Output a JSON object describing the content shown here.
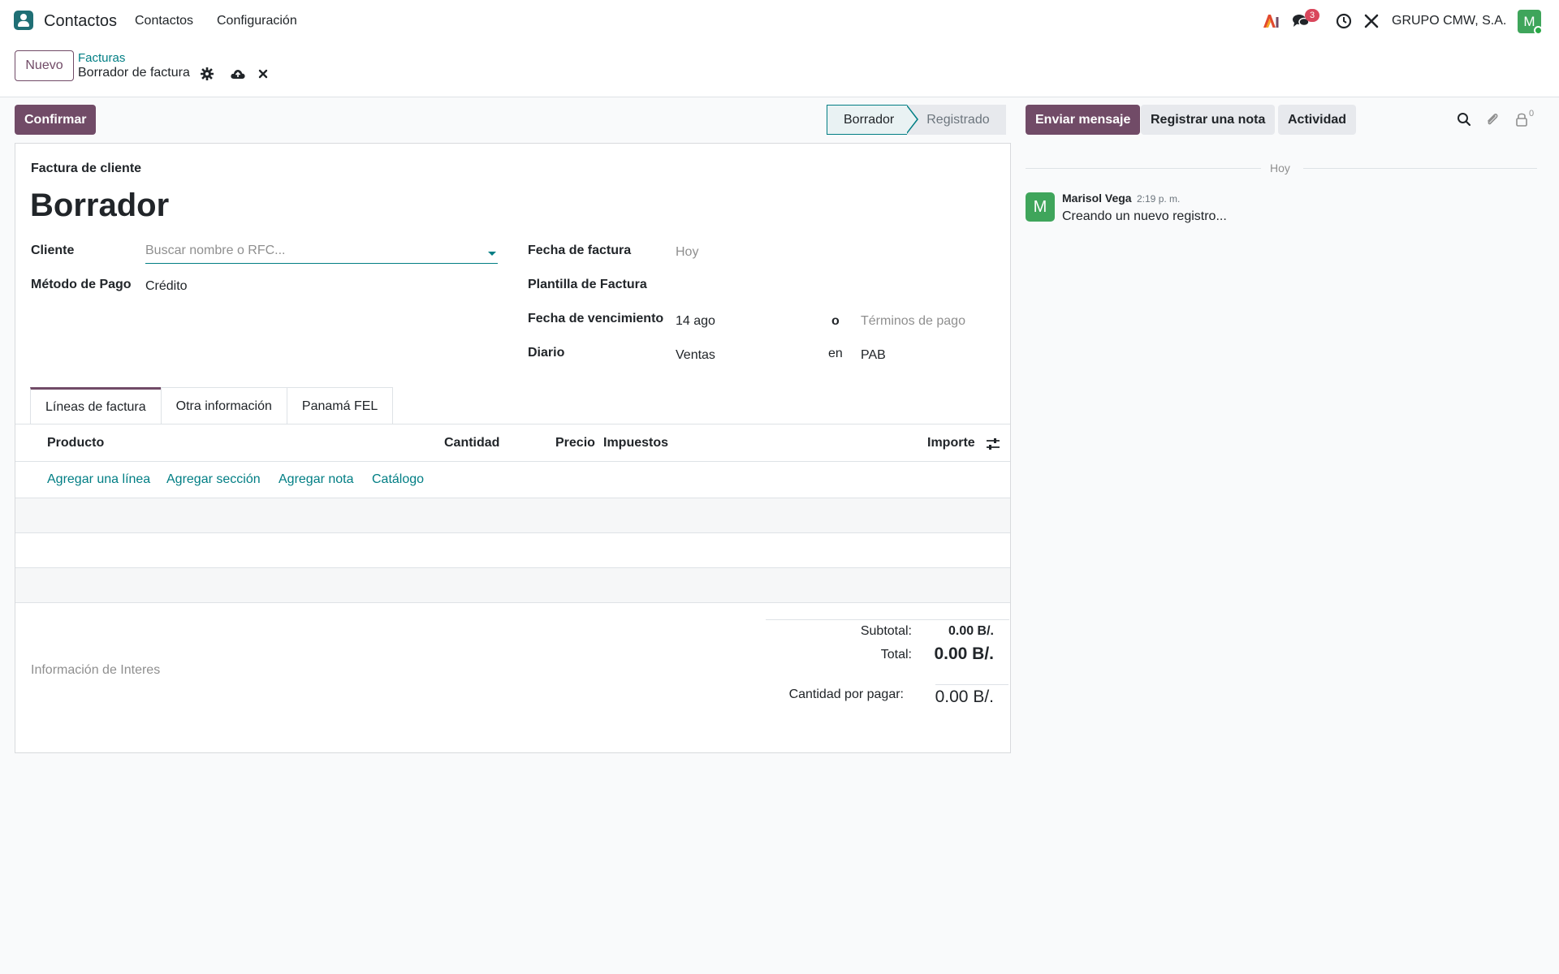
{
  "navbar": {
    "app_name": "Contactos",
    "menu": [
      "Contactos",
      "Configuración"
    ],
    "messages_count": "3",
    "company": "GRUPO CMW, S.A.",
    "user_initial": "M"
  },
  "control_panel": {
    "new_button": "Nuevo",
    "breadcrumb_parent": "Facturas",
    "record_name": "Borrador de factura"
  },
  "actions": {
    "confirm_button": "Confirmar"
  },
  "status_bar": {
    "stages": [
      "Borrador",
      "Registrado"
    ],
    "active_stage": "Borrador"
  },
  "form": {
    "document_type": "Factura de cliente",
    "title": "Borrador",
    "fields": {
      "client_label": "Cliente",
      "client_placeholder": "Buscar nombre o RFC...",
      "payment_method_label": "Método de Pago",
      "payment_method_value": "Crédito",
      "invoice_date_label": "Fecha de factura",
      "invoice_date_placeholder": "Hoy",
      "template_label": "Plantilla de Factura",
      "due_date_label": "Fecha de vencimiento",
      "due_date_value": "14 ago",
      "or_text": "o",
      "payment_terms_placeholder": "Términos de pago",
      "journal_label": "Diario",
      "journal_value": "Ventas",
      "in_text": "en",
      "currency_value": "PAB"
    },
    "tabs": [
      "Líneas de factura",
      "Otra información",
      "Panamá FEL"
    ],
    "active_tab": "Líneas de factura",
    "table": {
      "columns": [
        "Producto",
        "Cantidad",
        "Precio",
        "Impuestos",
        "Importe"
      ],
      "add_links": [
        "Agregar una línea",
        "Agregar sección",
        "Agregar nota",
        "Catálogo"
      ]
    },
    "notes_placeholder": "Información de Interes",
    "totals": {
      "subtotal_label": "Subtotal:",
      "subtotal_value": "0.00 B/.",
      "total_label": "Total:",
      "total_value": "0.00 B/.",
      "due_label": "Cantidad por pagar:",
      "due_value": "0.00 B/."
    }
  },
  "chatter": {
    "send_message": "Enviar mensaje",
    "log_note": "Registrar una nota",
    "activity": "Actividad",
    "followers_count": "0",
    "date_separator": "Hoy",
    "message": {
      "avatar_initial": "M",
      "author": "Marisol Vega",
      "time": "2:19 p. m.",
      "body": "Creando un nuevo registro..."
    }
  }
}
